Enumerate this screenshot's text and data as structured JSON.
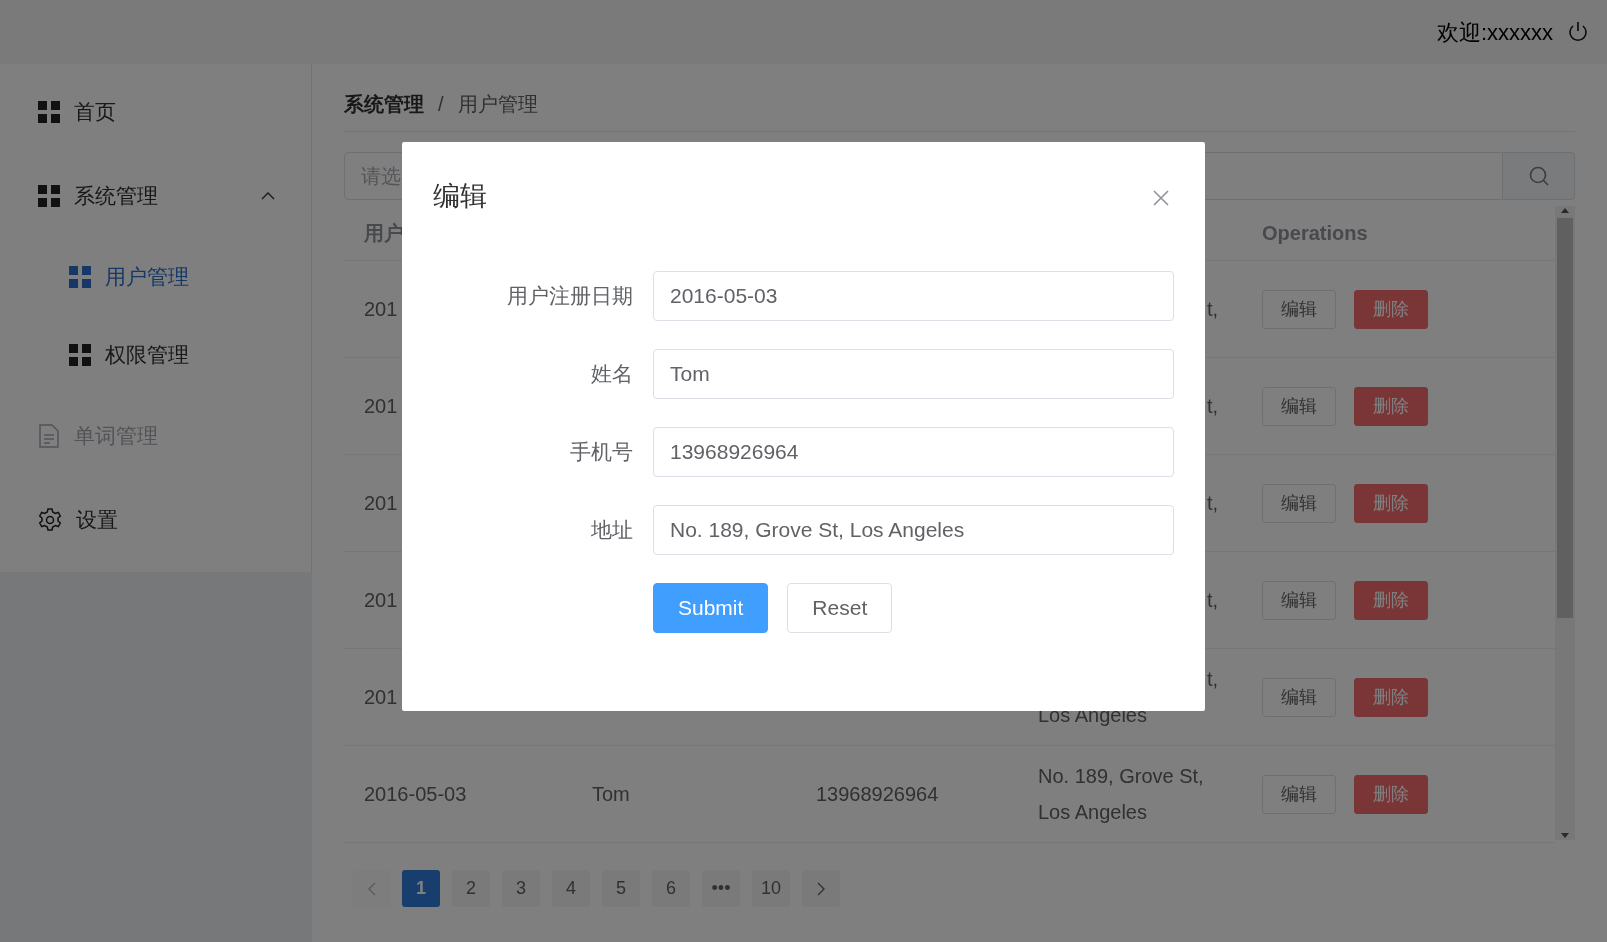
{
  "header": {
    "welcome": "欢迎:xxxxxx"
  },
  "sidebar": {
    "items": [
      {
        "label": "首页",
        "kind": "grid",
        "selected": false,
        "disabled": false
      },
      {
        "label": "系统管理",
        "kind": "grid",
        "selected": false,
        "disabled": false,
        "expanded": true,
        "children": [
          {
            "label": "用户管理",
            "kind": "grid",
            "selected": true,
            "disabled": false
          },
          {
            "label": "权限管理",
            "kind": "grid",
            "selected": false,
            "disabled": false
          }
        ]
      },
      {
        "label": "单词管理",
        "kind": "file",
        "selected": false,
        "disabled": true
      },
      {
        "label": "设置",
        "kind": "gear",
        "selected": false,
        "disabled": false
      }
    ]
  },
  "breadcrumb": {
    "separator": "/",
    "items": [
      "系统管理",
      "用户管理"
    ]
  },
  "search": {
    "placeholder": "请选"
  },
  "table": {
    "header": {
      "column_1": "用户",
      "operations": "Operations"
    },
    "rows": [
      {
        "date": "201",
        "address_lines": [
          "t,"
        ],
        "actions": [
          "编辑",
          "删除"
        ]
      },
      {
        "date": "201",
        "address_lines": [
          "t,"
        ],
        "actions": [
          "编辑",
          "删除"
        ]
      },
      {
        "date": "201",
        "address_lines": [
          "t,"
        ],
        "actions": [
          "编辑",
          "删除"
        ]
      },
      {
        "date": "201",
        "address_lines": [
          "t,"
        ],
        "actions": [
          "编辑",
          "删除"
        ]
      },
      {
        "date": "201",
        "address_lines": [
          "t,",
          "Los Angeles"
        ],
        "actions": [
          "编辑",
          "删除"
        ]
      },
      {
        "date": "2016-05-03",
        "name": "Tom",
        "phone": "13968926964",
        "address_lines": [
          "No. 189, Grove St,",
          "Los Angeles"
        ],
        "actions": [
          "编辑",
          "删除"
        ]
      }
    ]
  },
  "pagination": {
    "prev_disabled": true,
    "next_disabled": false,
    "pages": [
      {
        "label": "1",
        "selected": true
      },
      {
        "label": "2",
        "selected": false
      },
      {
        "label": "3",
        "selected": false
      },
      {
        "label": "4",
        "selected": false
      },
      {
        "label": "5",
        "selected": false
      },
      {
        "label": "6",
        "selected": false
      },
      {
        "label": "•••",
        "selected": false
      },
      {
        "label": "10",
        "selected": false
      }
    ]
  },
  "dialog": {
    "title": "编辑",
    "fields": [
      {
        "label": "用户注册日期",
        "value": "2016-05-03"
      },
      {
        "label": "姓名",
        "value": "Tom"
      },
      {
        "label": "手机号",
        "value": "13968926964"
      },
      {
        "label": "地址",
        "value": "No. 189, Grove St, Los Angeles"
      }
    ],
    "buttons": [
      {
        "label": "Submit",
        "kind": "primary"
      },
      {
        "label": "Reset",
        "kind": "default"
      }
    ]
  }
}
